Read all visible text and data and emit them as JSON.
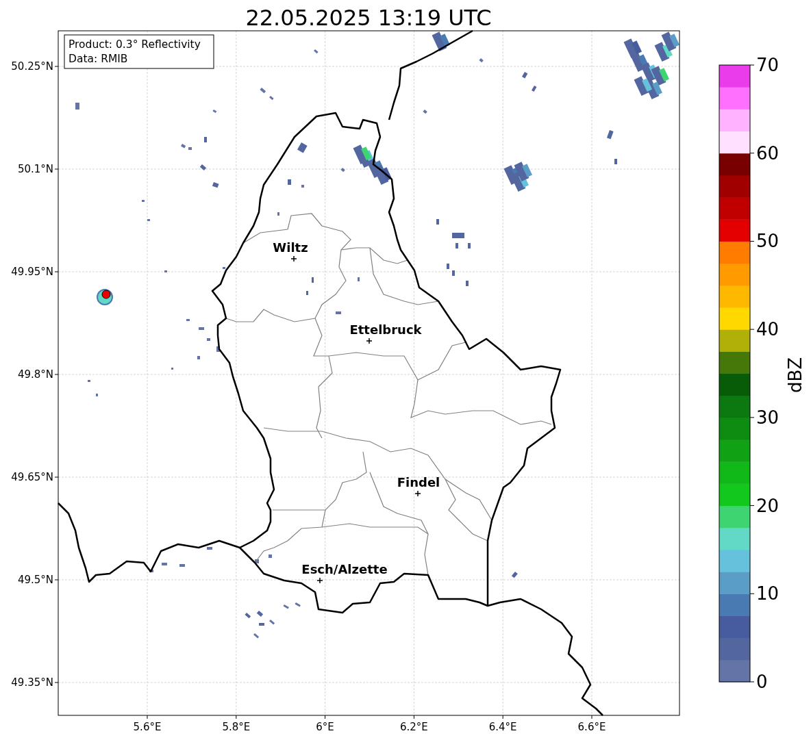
{
  "title": "22.05.2025 13:19 UTC",
  "info_box": {
    "lines": [
      "Product: 0.3° Reflectivity",
      "Data: RMIB"
    ]
  },
  "map": {
    "lat_ticks": [
      "50.25°N",
      "50.1°N",
      "49.95°N",
      "49.8°N",
      "49.65°N",
      "49.5°N",
      "49.35°N"
    ],
    "lon_ticks": [
      "5.6°E",
      "5.8°E",
      "6°E",
      "6.2°E",
      "6.4°E",
      "6.6°E"
    ],
    "cities": [
      {
        "name": "Wiltz"
      },
      {
        "name": "Ettelbruck"
      },
      {
        "name": "Findel"
      },
      {
        "name": "Esch/Alzette"
      }
    ]
  },
  "colorbar": {
    "label": "dBZ",
    "ticks": [
      "70",
      "60",
      "50",
      "40",
      "30",
      "20",
      "10",
      "0"
    ],
    "bins": [
      {
        "color": "#6574a6"
      },
      {
        "color": "#54669f"
      },
      {
        "color": "#465c9e"
      },
      {
        "color": "#4a7ab2"
      },
      {
        "color": "#5a9ec8"
      },
      {
        "color": "#66c2dc"
      },
      {
        "color": "#62d8c6"
      },
      {
        "color": "#3ed472"
      },
      {
        "color": "#12c81c"
      },
      {
        "color": "#10b818"
      },
      {
        "color": "#10a214"
      },
      {
        "color": "#0e8c12"
      },
      {
        "color": "#0c7810"
      },
      {
        "color": "#085c08"
      },
      {
        "color": "#457808"
      },
      {
        "color": "#b0b008"
      },
      {
        "color": "#ffd800"
      },
      {
        "color": "#ffb800"
      },
      {
        "color": "#ff9a00"
      },
      {
        "color": "#ff7c00"
      },
      {
        "color": "#e40000"
      },
      {
        "color": "#c00000"
      },
      {
        "color": "#a00000"
      },
      {
        "color": "#780000"
      },
      {
        "color": "#ffe0ff"
      },
      {
        "color": "#ffb2ff"
      },
      {
        "color": "#ff70ff"
      },
      {
        "color": "#ea3cea"
      }
    ]
  }
}
